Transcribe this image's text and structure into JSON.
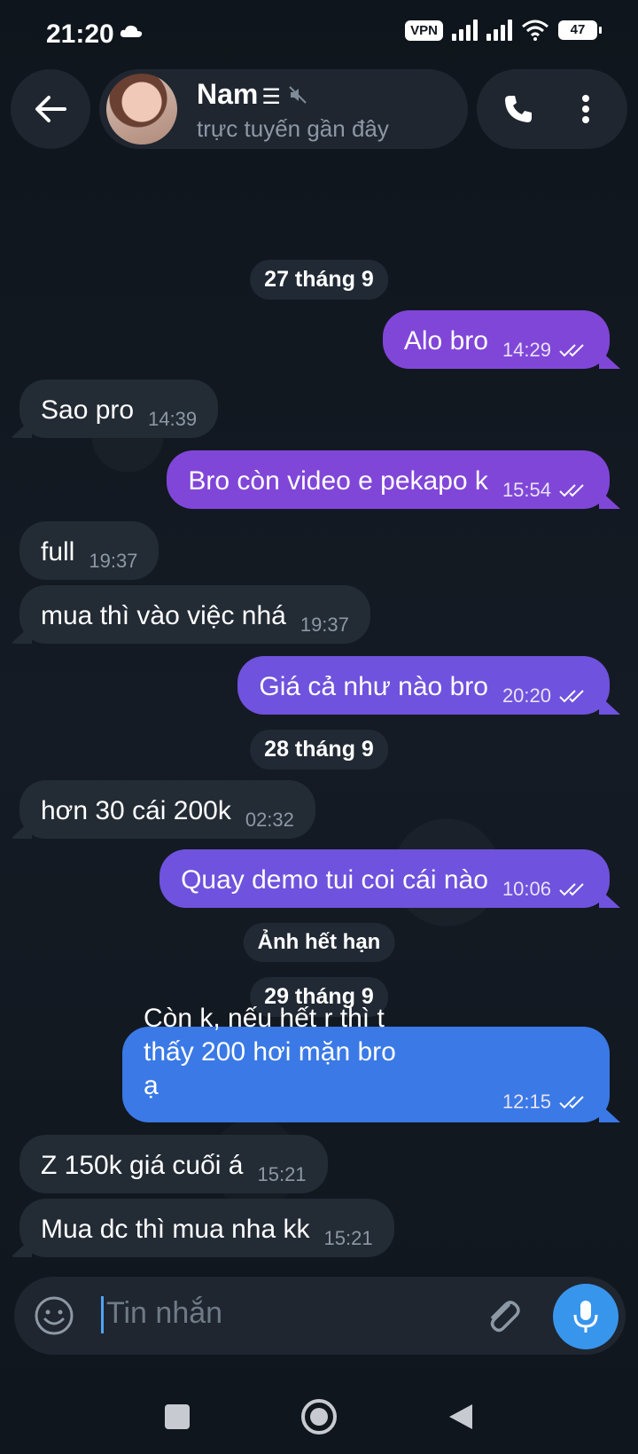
{
  "status": {
    "time": "21:20",
    "vpn": "VPN",
    "battery": "47"
  },
  "header": {
    "name": "Nam",
    "name_suffix": "☰",
    "status": "trực tuyến gần đây"
  },
  "dates": {
    "d1": "27 tháng 9",
    "d2": "28 tháng 9",
    "expired": "Ảnh hết hạn",
    "d3": "29 tháng 9"
  },
  "messages": [
    {
      "text": "Alo bro",
      "time": "14:29",
      "dir": "out"
    },
    {
      "text": "Sao pro",
      "time": "14:39",
      "dir": "in"
    },
    {
      "text": "Bro còn video e pekapo k",
      "time": "15:54",
      "dir": "out"
    },
    {
      "text": "full",
      "time": "19:37",
      "dir": "in"
    },
    {
      "text": "mua thì vào việc nhá",
      "time": "19:37",
      "dir": "in"
    },
    {
      "text": "Giá cả như nào bro",
      "time": "20:20",
      "dir": "out"
    },
    {
      "text": "hơn 30 cái 200k",
      "time": "02:32",
      "dir": "in"
    },
    {
      "text": "Quay demo tui coi cái nào",
      "time": "10:06",
      "dir": "out"
    },
    {
      "text": "Còn k, nếu hết r thì t thấy 200 hơi mặn bro ạ",
      "time": "12:15",
      "dir": "out"
    },
    {
      "text": "Z 150k giá cuối á",
      "time": "15:21",
      "dir": "in"
    },
    {
      "text": "Mua dc thì mua nha kk",
      "time": "15:21",
      "dir": "in"
    }
  ],
  "input": {
    "placeholder": "Tin nhắn"
  },
  "colors": {
    "bubble_in": "#232b35",
    "bubble_purple": "#8046d8",
    "bubble_blue": "#3a79e6",
    "mic": "#3895ec"
  },
  "icons": [
    "back-arrow-icon",
    "mute-icon",
    "phone-icon",
    "more-vert-icon",
    "emoji-icon",
    "attach-icon",
    "mic-icon",
    "double-check-icon",
    "nav-square-icon",
    "nav-circle-icon",
    "nav-back-icon"
  ]
}
